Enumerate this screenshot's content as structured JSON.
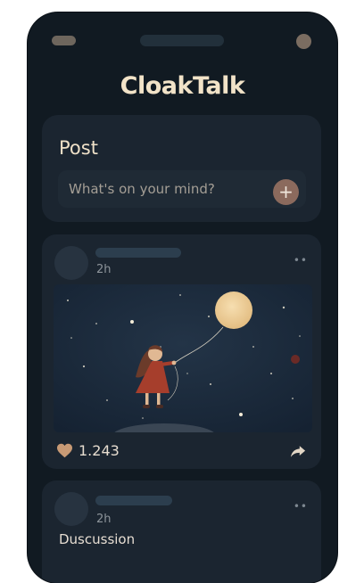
{
  "app": {
    "title": "CloakTalk"
  },
  "composer": {
    "title": "Post",
    "placeholder": "What's on your mind?",
    "add_icon": "plus-icon"
  },
  "feed": [
    {
      "time": "2h",
      "image": "girl-holding-moon-balloon-night-sky",
      "likes": "1.243"
    },
    {
      "time": "2h",
      "category": "Duscussion"
    }
  ],
  "colors": {
    "background": "#111a22",
    "card": "#1b2530",
    "accent": "#8b6a5d",
    "title": "#f2e3c8"
  }
}
